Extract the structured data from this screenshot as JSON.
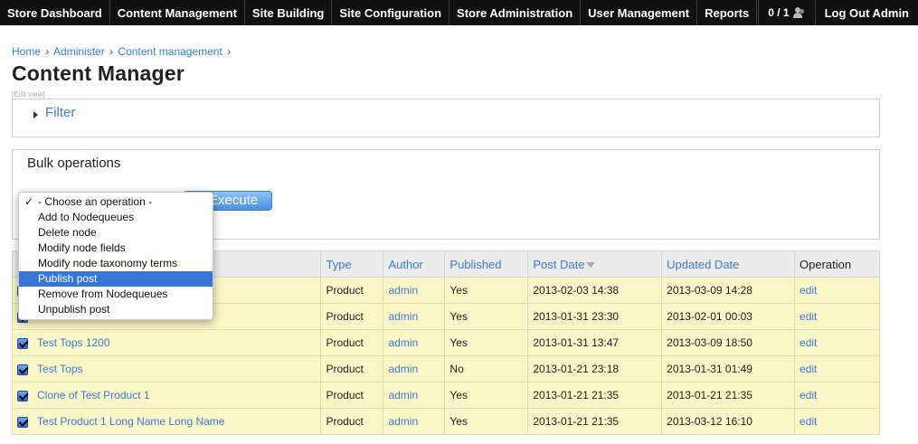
{
  "topbar": {
    "nav": [
      "Store Dashboard",
      "Content Management",
      "Site Building",
      "Site Configuration",
      "Store Administration",
      "User Management",
      "Reports"
    ],
    "users_count": "0 / 1",
    "users_icon": "users-icon",
    "logout": "Log Out Admin"
  },
  "breadcrumb": [
    "Home",
    "Administer",
    "Content management"
  ],
  "breadcrumb_sep": "›",
  "page": {
    "title": "Content Manager",
    "edit_view": "[Edit view]"
  },
  "filter": {
    "label": "Filter"
  },
  "bulk": {
    "title": "Bulk operations",
    "execute_label": "Execute",
    "options": [
      "- Choose an operation -",
      "Add to Nodequeues",
      "Delete node",
      "Modify node fields",
      "Modify node taxonomy terms",
      "Publish post",
      "Remove from Nodequeues",
      "Unpublish post"
    ],
    "selected_option": "- Choose an operation -",
    "highlighted_option": "Publish post"
  },
  "table": {
    "headers": [
      "Type",
      "Author",
      "Published",
      "Post Date",
      "Updated Date",
      "Operation"
    ],
    "rows": [
      {
        "checked": true,
        "title": "",
        "type": "Product",
        "author": "admin",
        "published": "Yes",
        "post_date": "2013-02-03 14:38",
        "updated_date": "2013-03-09 14:28",
        "op": "edit"
      },
      {
        "checked": true,
        "title": "",
        "type": "Product",
        "author": "admin",
        "published": "Yes",
        "post_date": "2013-01-31 23:30",
        "updated_date": "2013-02-01 00:03",
        "op": "edit"
      },
      {
        "checked": true,
        "title": "Test Tops 1200",
        "type": "Product",
        "author": "admin",
        "published": "Yes",
        "post_date": "2013-01-31 13:47",
        "updated_date": "2013-03-09 18:50",
        "op": "edit"
      },
      {
        "checked": true,
        "title": "Test Tops",
        "type": "Product",
        "author": "admin",
        "published": "No",
        "post_date": "2013-01-21 23:18",
        "updated_date": "2013-01-31 01:49",
        "op": "edit"
      },
      {
        "checked": true,
        "title": "Clone of Test Product 1",
        "type": "Product",
        "author": "admin",
        "published": "Yes",
        "post_date": "2013-01-21 21:35",
        "updated_date": "2013-01-21 21:35",
        "op": "edit"
      },
      {
        "checked": true,
        "title": "Test Product 1 Long Name Long Name",
        "type": "Product",
        "author": "admin",
        "published": "Yes",
        "post_date": "2013-01-21 21:35",
        "updated_date": "2013-03-12 16:10",
        "op": "edit"
      }
    ]
  },
  "colors": {
    "topbar_bg": "#101010",
    "link": "#3a7bd5",
    "row_bg": "#fbf6c8",
    "header_bg": "#ececec",
    "menu_highlight": "#3875d7"
  }
}
